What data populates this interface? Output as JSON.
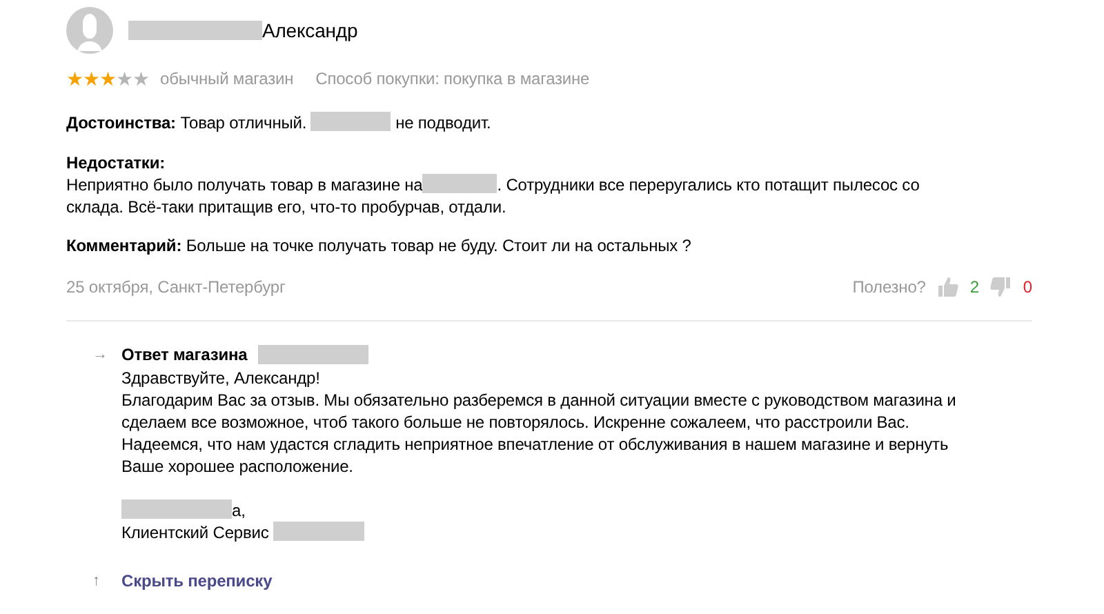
{
  "review": {
    "author": "Александр",
    "stars": 3,
    "rating_label": "обычный магазин",
    "purchase_method": "Способ покупки: покупка в магазине",
    "pros": {
      "label": "Достоинства:",
      "before": "Товар отличный.",
      "after": "не подводит."
    },
    "cons": {
      "label": "Недостатки:",
      "before": "Неприятно было получать товар в магазине на",
      "after": ". Сотрудники все переругались кто потащит пылесос со",
      "continuation": "склада. Всё-таки притащив его, что-то пробурчав, отдали."
    },
    "comment": {
      "label": "Комментарий:",
      "text": "Больше на точке получать товар не буду. Стоит ли на остальных ?"
    },
    "meta": "25 октября, Санкт-Петербург",
    "helpful": {
      "label": "Полезно?",
      "likes": "2",
      "dislikes": "0"
    }
  },
  "reply": {
    "arrow": "→",
    "title": "Ответ магазина",
    "lines": [
      "Здравствуйте, Александр!",
      "Благодарим Вас за отзыв. Мы обязательно разберемся в данной ситуации вместе с руководством магазина и",
      "сделаем все возможное, чтоб такого больше не повторялось. Искренне сожалеем, что расстроили Вас.",
      "Надеемся, что нам удастся сгладить неприятное впечатление от обслуживания в нашем магазине и вернуть",
      "Ваше хорошее расположение."
    ],
    "signature_suffix": "а,",
    "signature_service": "Клиентский Сервис",
    "hide_arrow": "↑",
    "hide_link": "Скрыть переписку"
  }
}
